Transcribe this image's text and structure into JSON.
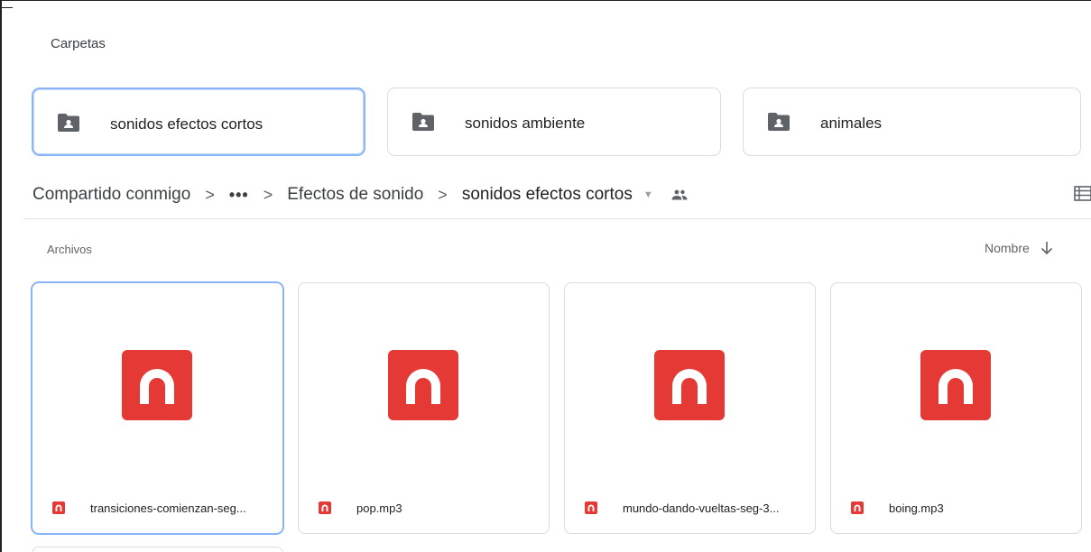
{
  "folders_section": {
    "title": "Carpetas"
  },
  "folders": [
    {
      "label": "sonidos efectos cortos",
      "selected": true
    },
    {
      "label": "sonidos ambiente",
      "selected": false
    },
    {
      "label": "animales",
      "selected": false
    }
  ],
  "breadcrumb": {
    "root": "Compartido conmigo",
    "ellipsis": "•••",
    "parent": "Efectos de sonido",
    "current": "sonidos efectos cortos",
    "separator": ">",
    "dropdown": "▼"
  },
  "files_section": {
    "title": "Archivos",
    "sort_label": "Nombre"
  },
  "files": [
    {
      "name": "transiciones-comienzan-seg...",
      "icon": "audio-file-icon",
      "selected": true
    },
    {
      "name": "pop.mp3",
      "icon": "audio-file-icon",
      "selected": false
    },
    {
      "name": "mundo-dando-vueltas-seg-3...",
      "icon": "audio-file-icon",
      "selected": false
    },
    {
      "name": "boing.mp3",
      "icon": "audio-file-icon",
      "selected": false
    }
  ],
  "colors": {
    "audio_red": "#e53935",
    "folder_gray": "#5f6368",
    "selected_border": "#8ab4f8"
  }
}
